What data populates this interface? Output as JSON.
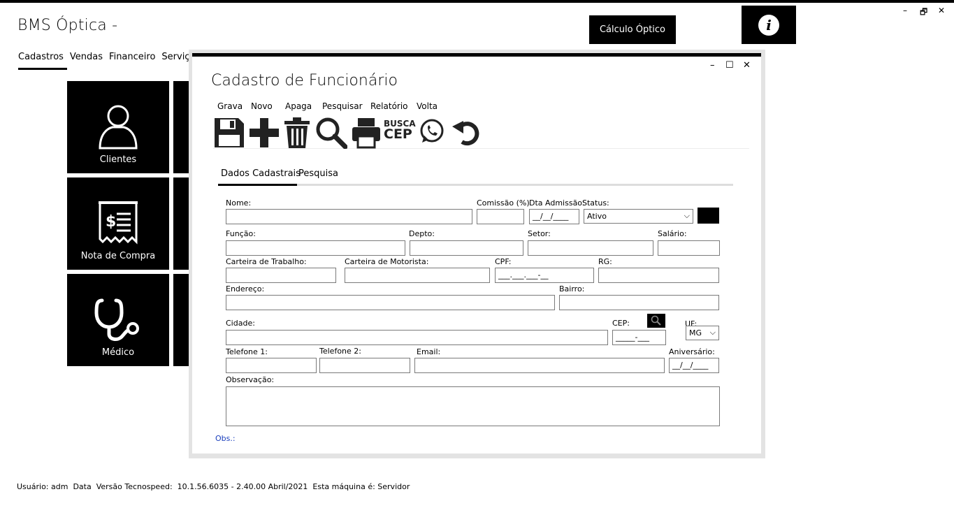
{
  "app": {
    "title": "BMS Óptica -"
  },
  "window_controls": {
    "minimize": "–",
    "restore": "🗗",
    "close": "✕"
  },
  "header": {
    "calc_button": "Cálculo Óptico",
    "info_button": "i"
  },
  "main_menu": [
    "Cadastros",
    "Vendas",
    "Financeiro",
    "Serviços"
  ],
  "tiles": [
    {
      "label": "Clientes",
      "icon": "user-icon"
    },
    {
      "label": "Nota de Compra",
      "icon": "receipt-icon"
    },
    {
      "label": "Médico",
      "icon": "stethoscope-icon"
    }
  ],
  "dialog": {
    "title": "Cadastro de Funcionário",
    "controls": {
      "minimize": "–",
      "maximize": "☐",
      "close": "✕"
    },
    "menu": [
      "Grava",
      "Novo",
      "Apaga",
      "Pesquisar",
      "Relatório",
      "Volta"
    ],
    "toolbar": {
      "busca_cep": {
        "line1": "BUSCA",
        "line2": "CEP"
      },
      "icons": [
        "save-icon",
        "plus-icon",
        "trash-icon",
        "search-icon",
        "printer-icon",
        "busca-cep-icon",
        "whatsapp-icon",
        "undo-icon"
      ]
    },
    "tabs": [
      "Dados Cadastrais",
      "Pesquisa"
    ],
    "form": {
      "nome": {
        "label": "Nome:",
        "value": ""
      },
      "comissao": {
        "label": "Comissão (%)",
        "value": ""
      },
      "dta_admissao": {
        "label": "Dta Admissão:",
        "value": "__/__/____"
      },
      "status": {
        "label": "Status:",
        "value": "Ativo"
      },
      "funcao": {
        "label": "Função:",
        "value": ""
      },
      "depto": {
        "label": "Depto:",
        "value": ""
      },
      "setor": {
        "label": "Setor:",
        "value": ""
      },
      "salario": {
        "label": "Salário:",
        "value": ""
      },
      "carteira_trabalho": {
        "label": "Carteira de Trabalho:",
        "value": ""
      },
      "carteira_motorista": {
        "label": "Carteira de Motorista:",
        "value": ""
      },
      "cpf": {
        "label": "CPF:",
        "value": "___.___.___-__"
      },
      "rg": {
        "label": "RG:",
        "value": ""
      },
      "endereco": {
        "label": "Endereço:",
        "value": ""
      },
      "bairro": {
        "label": "Bairro:",
        "value": ""
      },
      "cidade": {
        "label": "Cidade:",
        "value": ""
      },
      "cep": {
        "label": "CEP:",
        "value": "_____-___"
      },
      "uf": {
        "label": "UF:",
        "value": "MG"
      },
      "telefone1": {
        "label": "Telefone 1:",
        "value": ""
      },
      "telefone2": {
        "label": "Telefone 2:",
        "value": ""
      },
      "email": {
        "label": "Email:",
        "value": ""
      },
      "aniversario": {
        "label": "Aniversário:",
        "value": "__/__/____"
      },
      "observacao": {
        "label": "Observação:",
        "value": ""
      }
    },
    "obs_link": "Obs.:"
  },
  "status_bar": "Usuário: adm  Data  Versão Tecnospeed:  10.1.56.6035 - 2.40.00 Abril/2021  Esta máquina é: Servidor"
}
